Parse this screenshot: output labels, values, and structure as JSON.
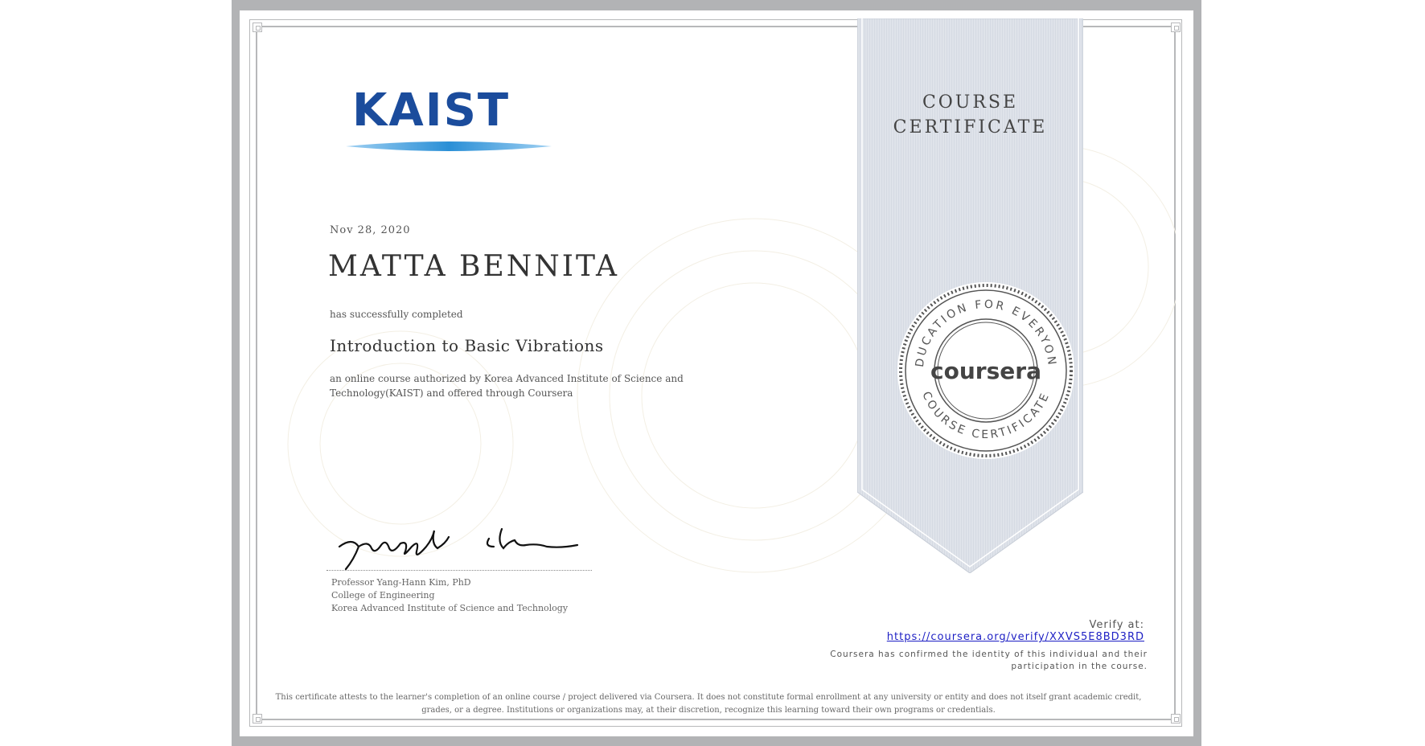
{
  "logo": {
    "text": "KAIST",
    "color": "#1b4c9c",
    "swoosh_color": "#2a8fd6"
  },
  "date": "Nov 28, 2020",
  "recipient_name": "MATTA BENNITA",
  "completed_text": "has successfully completed",
  "course_title": "Introduction to Basic Vibrations",
  "description": "an online course authorized by Korea Advanced Institute of Science and Technology(KAIST) and offered through Coursera",
  "signer": {
    "name": "Professor Yang-Hann Kim, PhD",
    "department": "College of Engineering",
    "institution": "Korea Advanced Institute of Science and Technology"
  },
  "ribbon": {
    "title_line1": "COURSE",
    "title_line2": "CERTIFICATE",
    "color": "#dfe3ea"
  },
  "seal": {
    "top_text": "EDUCATION FOR EVERYONE",
    "center_text": "coursera",
    "bottom_text": "COURSE CERTIFICATE"
  },
  "verify": {
    "label": "Verify at:",
    "url": "https://coursera.org/verify/XXVS5E8BD3RD",
    "note": "Coursera has confirmed the identity of this individual and their participation in the course."
  },
  "footer": "This certificate attests to the learner's completion of an online course / project delivered via Coursera. It does not constitute formal enrollment at any university or entity and does not itself grant academic credit, grades, or a degree. Institutions or organizations may, at their discretion, recognize this learning toward their own programs or credentials.",
  "colors": {
    "frame": "#b2b3b5",
    "link": "#1d1fc4",
    "text": "#333333"
  }
}
